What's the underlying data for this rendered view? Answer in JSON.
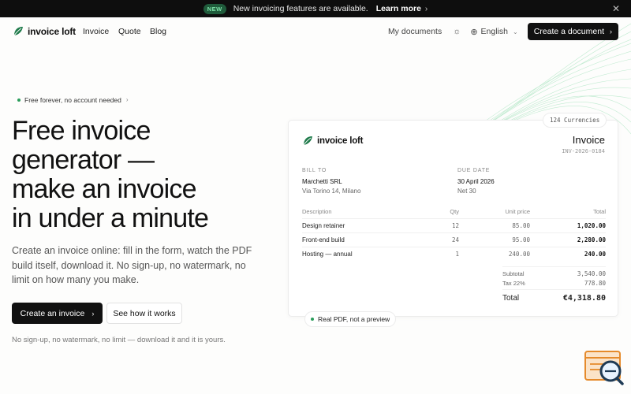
{
  "announce": {
    "badge": "NEW",
    "message": "New invoicing features are available.",
    "link": "Learn more"
  },
  "nav": {
    "brand": "invoice loft",
    "links": [
      "Invoice",
      "Quote",
      "Blog"
    ],
    "my_documents": "My documents",
    "language": "English",
    "cta": "Create a document"
  },
  "hero": {
    "badge": "Free forever, no account needed",
    "title_lines": [
      "Free invoice",
      "generator —",
      "make an invoice",
      "in under a minute"
    ],
    "subtitle": "Create an invoice online: fill in the form, watch the PDF build itself, download it. No sign-up, no watermark, no limit on how many you make.",
    "primary_button": "Create an invoice",
    "secondary_button": "See how it works",
    "fineprint": "No sign-up, no watermark, no limit — download it and it is yours."
  },
  "invoice": {
    "currencies_pill": "124 Currencies",
    "brand": "invoice loft",
    "title": "Invoice",
    "number": "INV-2026-0184",
    "bill_to_label": "BILL TO",
    "client_name": "Marchetti SRL",
    "client_address": "Via Torino 14, Milano",
    "due_date_label": "DUE DATE",
    "due_date": "30 April 2026",
    "terms": "Net 30",
    "columns": [
      "Description",
      "Qty",
      "Unit price",
      "Total"
    ],
    "items": [
      {
        "description": "Design retainer",
        "qty": "12",
        "unit_price": "85.00",
        "total": "1,020.00"
      },
      {
        "description": "Front-end build",
        "qty": "24",
        "unit_price": "95.00",
        "total": "2,280.00"
      },
      {
        "description": "Hosting — annual",
        "qty": "1",
        "unit_price": "240.00",
        "total": "240.00"
      }
    ],
    "subtotal_label": "Subtotal",
    "subtotal": "3,540.00",
    "tax_label": "Tax 22%",
    "tax": "778.80",
    "total_label": "Total",
    "total": "€4,318.80",
    "pdf_pill": "Real PDF, not a preview"
  },
  "colors": {
    "accent_green": "#2a9d5b",
    "dark": "#111111",
    "new_badge_bg": "#1f5b3b"
  }
}
